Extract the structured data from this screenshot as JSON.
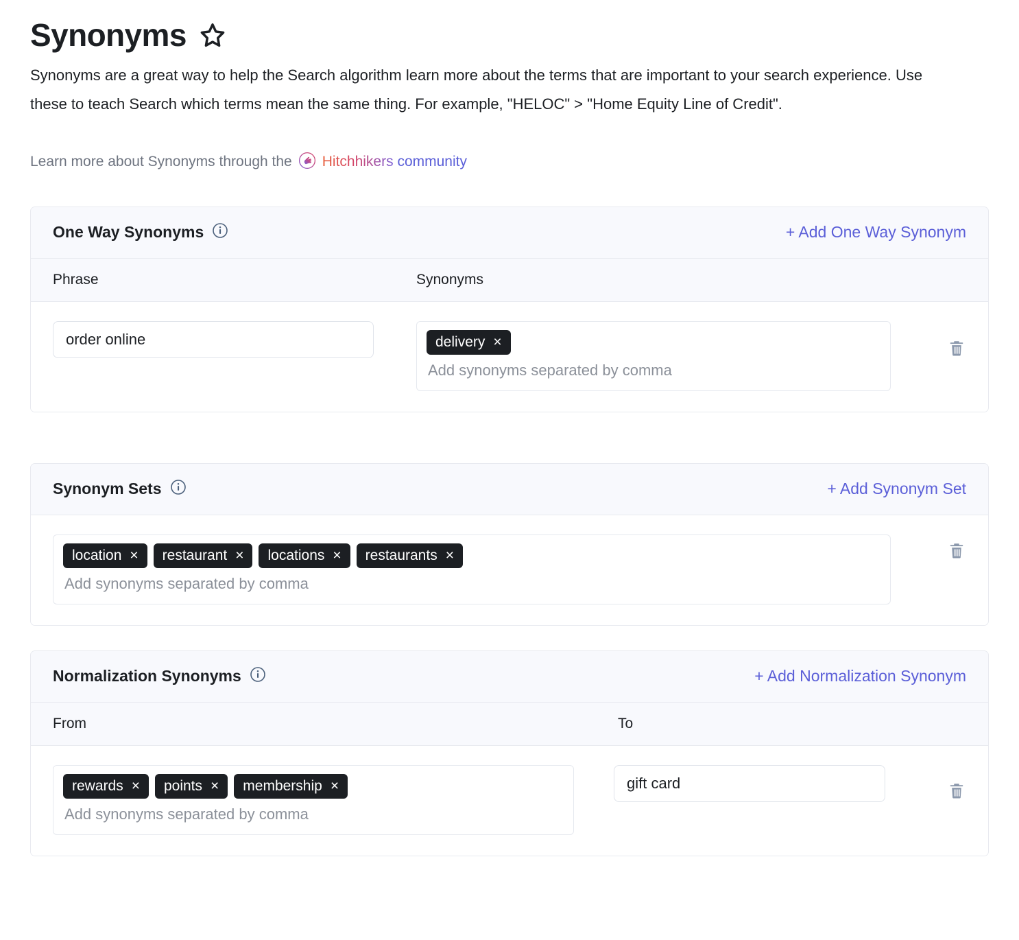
{
  "header": {
    "title": "Synonyms",
    "star_icon": "star-outline-icon",
    "description": "Synonyms are a great way to help the Search algorithm learn more about the terms that are important to your search experience. Use these to teach Search which terms mean the same thing. For example, \"HELOC\" > \"Home Equity Line of Credit\".",
    "learn_more_prefix": "Learn more about Synonyms through the",
    "hitchhikers_icon": "hitchhikers-hand-icon",
    "link_brand": "Hitchhikers",
    "link_suffix": " community"
  },
  "colors": {
    "accent_link": "#5b5fd8",
    "tag_background": "#1c1f23",
    "card_header_background": "#f8f9fd",
    "card_border": "#e8eaf0",
    "trash_icon": "#8b98ac",
    "info_icon": "#4a5f7a",
    "placeholder_text": "#8b9099"
  },
  "one_way_synonyms": {
    "title": "One Way Synonyms",
    "info_icon": "info-circle-icon",
    "add_label": "+ Add One Way Synonym",
    "columns": [
      "Phrase",
      "Synonyms"
    ],
    "rows": [
      {
        "phrase": "order online",
        "phrase_placeholder": "",
        "synonyms": [
          "delivery"
        ],
        "synonyms_placeholder": "Add synonyms separated by comma",
        "delete_icon": "trash-icon"
      }
    ]
  },
  "synonym_sets": {
    "title": "Synonym Sets",
    "info_icon": "info-circle-icon",
    "add_label": "+ Add Synonym Set",
    "rows": [
      {
        "synonyms": [
          "location",
          "restaurant",
          "locations",
          "restaurants"
        ],
        "placeholder": "Add synonyms separated by comma",
        "delete_icon": "trash-icon"
      }
    ]
  },
  "normalization_synonyms": {
    "title": "Normalization Synonyms",
    "info_icon": "info-circle-icon",
    "add_label": "+ Add Normalization Synonym",
    "columns": [
      "From",
      "To"
    ],
    "rows": [
      {
        "from": [
          "rewards",
          "points",
          "membership"
        ],
        "from_placeholder": "Add synonyms separated by comma",
        "to": "gift card",
        "delete_icon": "trash-icon"
      }
    ]
  },
  "tag_remove_glyph": "×"
}
